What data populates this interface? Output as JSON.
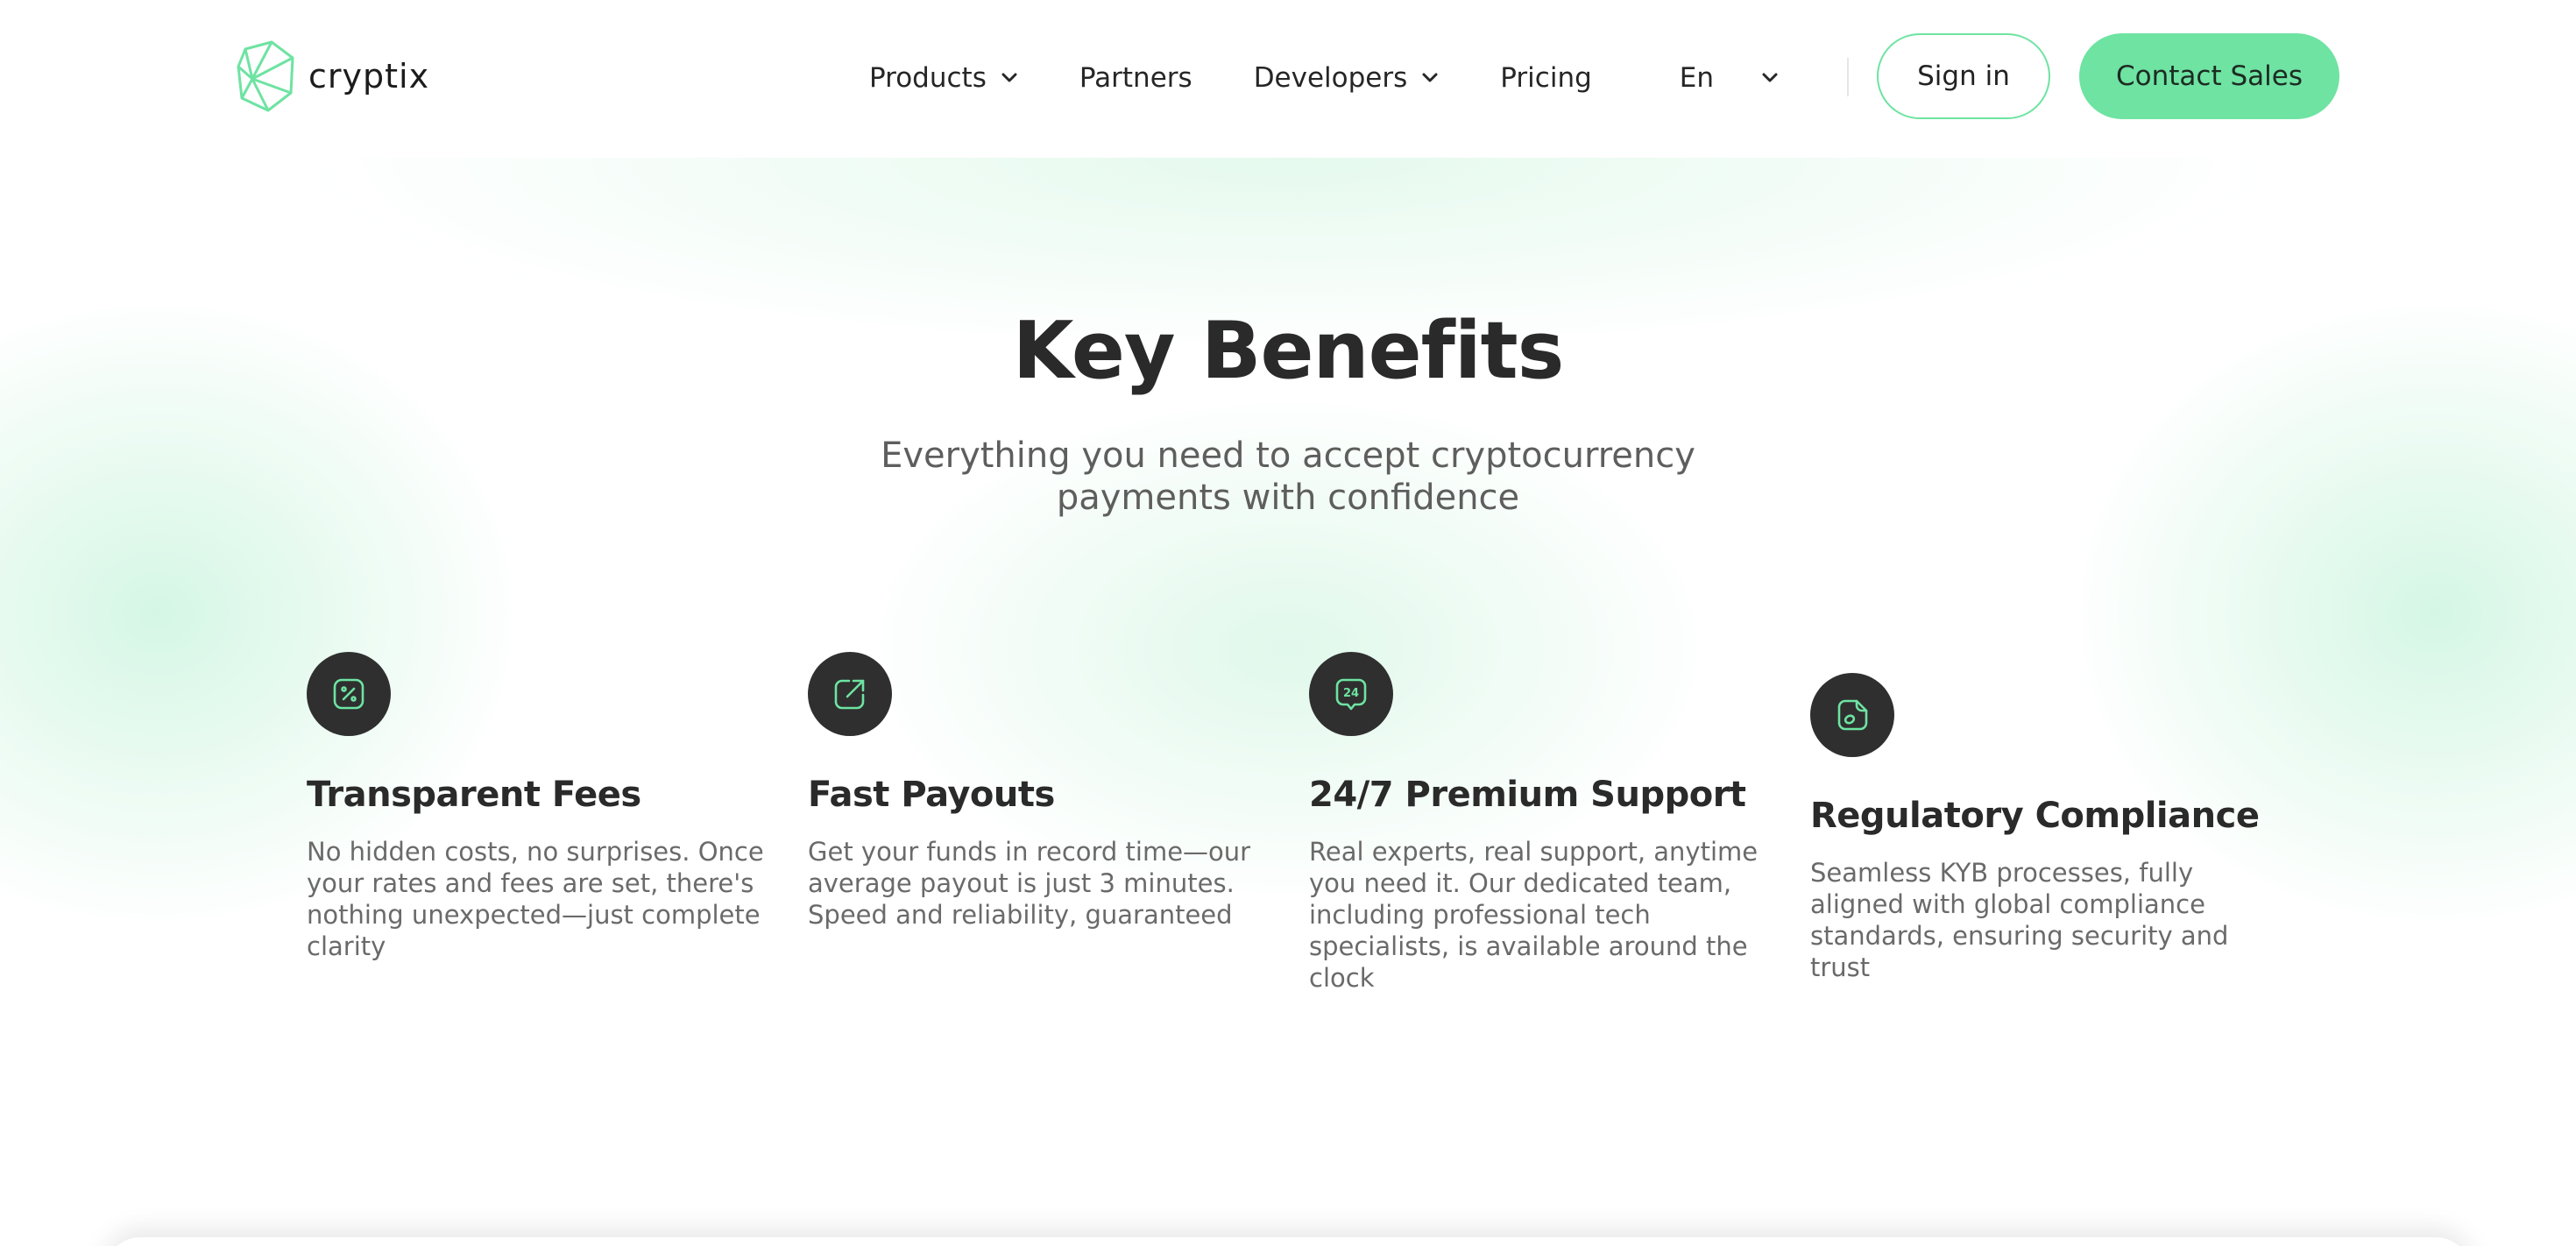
{
  "header": {
    "logo_text": "cryptix",
    "nav": {
      "products": "Products",
      "partners": "Partners",
      "developers": "Developers",
      "pricing": "Pricing",
      "language": "En"
    },
    "sign_in": "Sign in",
    "contact_sales": "Contact Sales"
  },
  "hero": {
    "title": "Key Benefits",
    "subtitle": "Everything you need to accept cryptocurrency payments with confidence"
  },
  "benefits": [
    {
      "icon": "percent-icon",
      "title": "Transparent Fees",
      "text": "No hidden costs, no surprises. Once your rates and fees are set, there's nothing unexpected—just complete clarity"
    },
    {
      "icon": "external-arrow-icon",
      "title": "Fast Payouts",
      "text": "Get your funds in record time—our average payout is just 3 minutes. Speed and reliability, guaranteed"
    },
    {
      "icon": "support-24-icon",
      "icon_label": "24",
      "title": "24/7 Premium Support",
      "text": "Real experts, real support, anytime you need it. Our dedicated team, including professional tech specialists, is available around the clock"
    },
    {
      "icon": "document-icon",
      "title": "Regulatory Compliance",
      "text": "Seamless KYB processes, fully aligned with global compliance standards, ensuring security and trust"
    }
  ],
  "colors": {
    "accent": "#6ee3a2",
    "icon_bg": "#2f2f2f",
    "heading": "#2a2a2a",
    "body_text": "#6a6a6a"
  }
}
